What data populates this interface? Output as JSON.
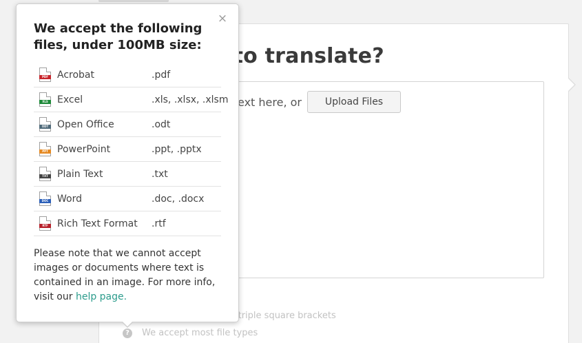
{
  "main": {
    "heading": "d you like to translate?",
    "text_prompt": "text here, or",
    "upload_label": "Upload Files",
    "hint_brackets": "from translation]]] in triple square brackets",
    "hint_files": "We accept most file types",
    "help_icon_glyph": "?"
  },
  "popover": {
    "close_glyph": "×",
    "title": "We accept the following files, under 100MB size:",
    "files": [
      {
        "name": "Acrobat",
        "ext": ".pdf",
        "tag": "PDF",
        "color": "#c8242b",
        "icon": "pdf-file-icon"
      },
      {
        "name": "Excel",
        "ext": ".xls, .xlsx, .xlsm",
        "tag": "XLS",
        "color": "#1f8a3a",
        "icon": "excel-file-icon"
      },
      {
        "name": "Open Office",
        "ext": ".odt",
        "tag": "ODT",
        "color": "#4f6a7a",
        "icon": "odt-file-icon"
      },
      {
        "name": "PowerPoint",
        "ext": ".ppt, .pptx",
        "tag": "PPT",
        "color": "#e58a23",
        "icon": "powerpoint-file-icon"
      },
      {
        "name": "Plain Text",
        "ext": ".txt",
        "tag": "TXT",
        "color": "#444444",
        "icon": "text-file-icon"
      },
      {
        "name": "Word",
        "ext": ".doc, .docx",
        "tag": "DOC",
        "color": "#2b5fb9",
        "icon": "word-file-icon"
      },
      {
        "name": "Rich Text Format",
        "ext": ".rtf",
        "tag": "RTF",
        "color": "#b7202a",
        "icon": "rtf-file-icon"
      }
    ],
    "note": "Please note that we cannot accept images or documents where text is contained in an image. For more info, visit our ",
    "help_link": "help page."
  },
  "colors": {
    "link": "#2c9c8c"
  }
}
